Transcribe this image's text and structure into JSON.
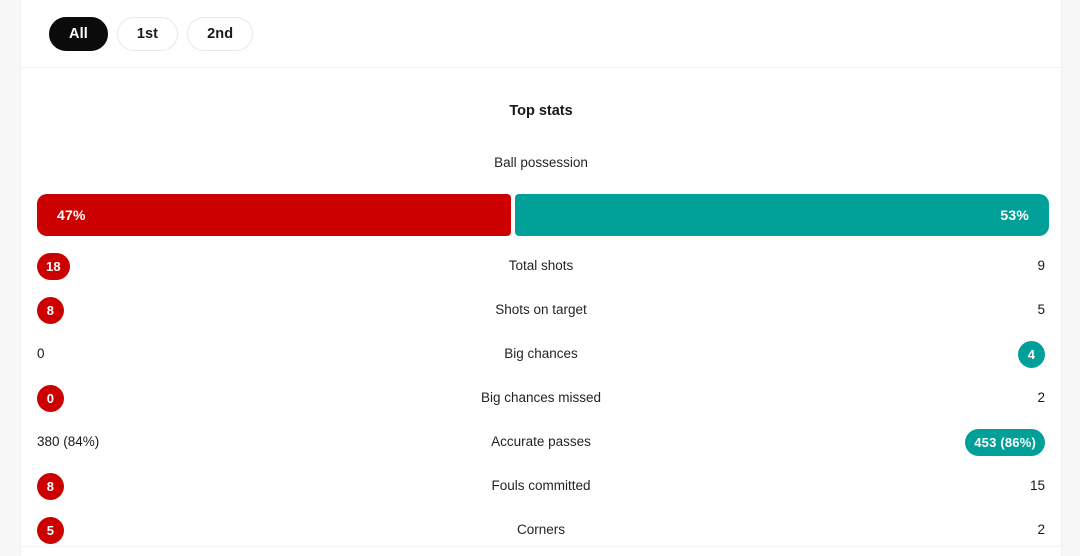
{
  "theme": {
    "home_color": "#cc0000",
    "away_color": "#00a099",
    "active_chip_bg": "#0b0b0c",
    "panel_bg": "#ffffff",
    "page_bg": "#f7f7f8",
    "text_color": "#16181a"
  },
  "period_filter": {
    "options": [
      {
        "label": "All",
        "active": true
      },
      {
        "label": "1st",
        "active": false
      },
      {
        "label": "2nd",
        "active": false
      }
    ]
  },
  "stats": {
    "section_title": "Top stats",
    "possession": {
      "label": "Ball possession",
      "home_value": "47%",
      "away_value": "53%",
      "home_pct": 47,
      "away_pct": 53
    },
    "rows": [
      {
        "label": "Total shots",
        "home": {
          "value": "18",
          "style": "badge"
        },
        "away": {
          "value": "9",
          "style": "plain"
        }
      },
      {
        "label": "Shots on target",
        "home": {
          "value": "8",
          "style": "badge"
        },
        "away": {
          "value": "5",
          "style": "plain"
        }
      },
      {
        "label": "Big chances",
        "home": {
          "value": "0",
          "style": "plain"
        },
        "away": {
          "value": "4",
          "style": "badge"
        }
      },
      {
        "label": "Big chances missed",
        "home": {
          "value": "0",
          "style": "badge"
        },
        "away": {
          "value": "2",
          "style": "plain"
        }
      },
      {
        "label": "Accurate passes",
        "home": {
          "value": "380 (84%)",
          "style": "plain"
        },
        "away": {
          "value": "453 (86%)",
          "style": "badge"
        }
      },
      {
        "label": "Fouls committed",
        "home": {
          "value": "8",
          "style": "badge"
        },
        "away": {
          "value": "15",
          "style": "plain"
        }
      },
      {
        "label": "Corners",
        "home": {
          "value": "5",
          "style": "badge"
        },
        "away": {
          "value": "2",
          "style": "plain"
        }
      }
    ]
  }
}
